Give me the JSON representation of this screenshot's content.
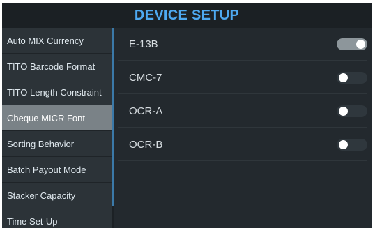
{
  "header": {
    "title": "DEVICE SETUP"
  },
  "sidebar": {
    "items": [
      {
        "label": "Auto MIX Currency",
        "active": false
      },
      {
        "label": "TITO Barcode Format",
        "active": false
      },
      {
        "label": "TITO Length Constraint",
        "active": false
      },
      {
        "label": "Cheque MICR Font",
        "active": true
      },
      {
        "label": "Sorting Behavior",
        "active": false
      },
      {
        "label": "Batch Payout Mode",
        "active": false
      },
      {
        "label": "Stacker Capacity",
        "active": false
      },
      {
        "label": "Time Set-Up",
        "active": false
      }
    ]
  },
  "options": [
    {
      "label": "E-13B",
      "enabled": true
    },
    {
      "label": "CMC-7",
      "enabled": false
    },
    {
      "label": "OCR-A",
      "enabled": false
    },
    {
      "label": "OCR-B",
      "enabled": false
    }
  ],
  "colors": {
    "accent": "#4ea9f1",
    "background": "#23292e",
    "sidebar": "#2c3338",
    "active_item": "#7a8287"
  }
}
